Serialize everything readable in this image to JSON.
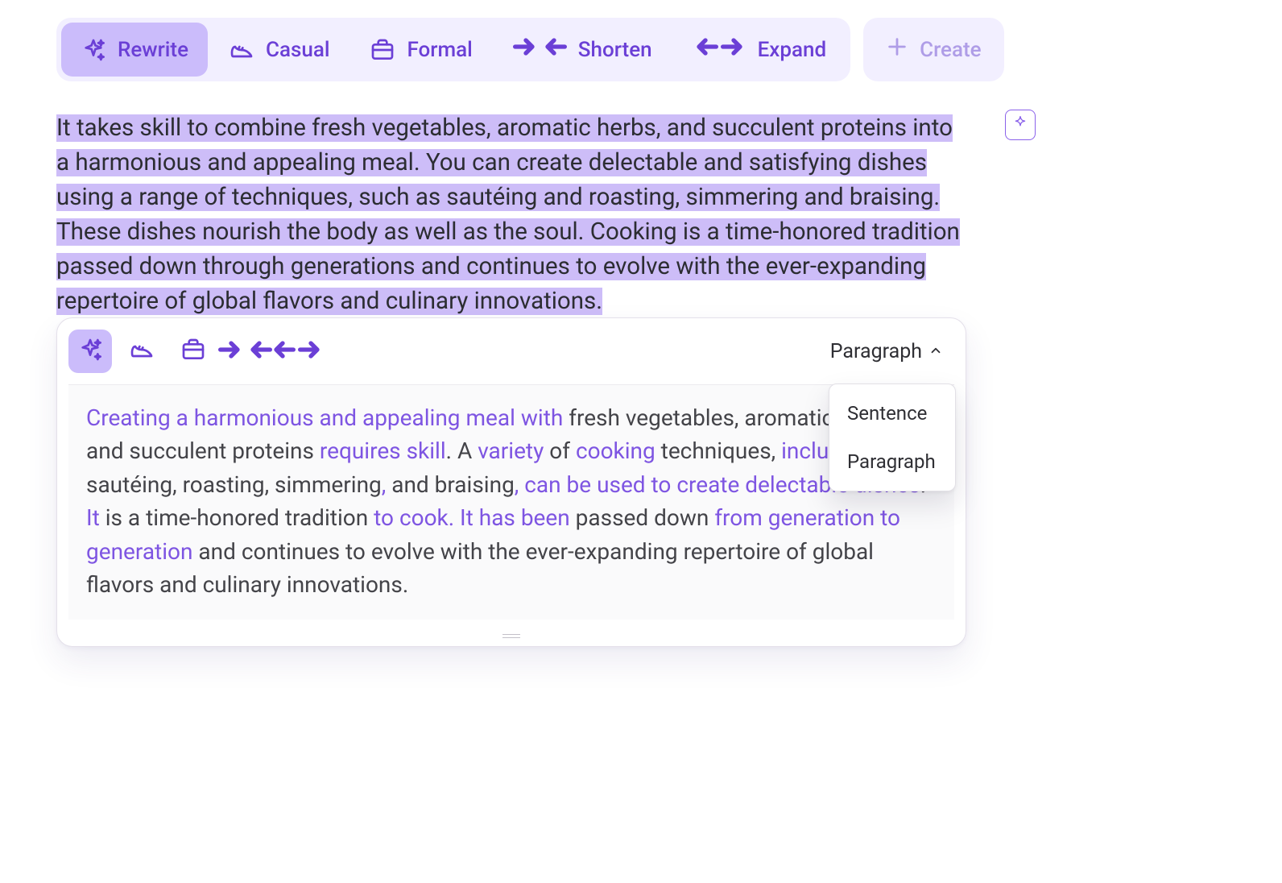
{
  "toolbar": {
    "rewrite": "Rewrite",
    "casual": "Casual",
    "formal": "Formal",
    "shorten": "Shorten",
    "expand": "Expand",
    "create": "Create"
  },
  "original_text": "It takes skill to combine fresh vegetables, aromatic herbs, and succulent proteins into a harmonious and appealing meal. You can create delectable and satisfying dishes using a range of techniques, such as sautéing and roasting, simmering and braising. These dishes nourish the body as well as the soul. Cooking is a time-honored tradition passed down through generations and continues to evolve with the ever-expanding repertoire of global flavors and culinary innovations.",
  "result": {
    "segments": [
      {
        "t": "Creating a harmonious and appealing meal with",
        "c": true
      },
      {
        "t": " fresh vegetables, aromatic herbs, and succulent proteins ",
        "c": false
      },
      {
        "t": "requires skill",
        "c": true
      },
      {
        "t": ". A ",
        "c": false
      },
      {
        "t": "variety",
        "c": true
      },
      {
        "t": " of ",
        "c": false
      },
      {
        "t": "cooking",
        "c": true
      },
      {
        "t": " techniques, ",
        "c": false
      },
      {
        "t": "including",
        "c": true
      },
      {
        "t": " sautéing, roasting, simmering",
        "c": false
      },
      {
        "t": ",",
        "c": true
      },
      {
        "t": " and braising",
        "c": false
      },
      {
        "t": ", can be used to create delectable dishes",
        "c": true
      },
      {
        "t": ". ",
        "c": false
      },
      {
        "t": "It",
        "c": true
      },
      {
        "t": " is a time-honored tradition ",
        "c": false
      },
      {
        "t": "to cook. It has been",
        "c": true
      },
      {
        "t": " passed down ",
        "c": false
      },
      {
        "t": "from generation to generation",
        "c": true
      },
      {
        "t": " and continues to evolve with the ever-expanding repertoire of global flavors and culinary innovations.",
        "c": false
      }
    ]
  },
  "scope": {
    "selected": "Paragraph",
    "options": [
      "Sentence",
      "Paragraph"
    ]
  },
  "icons": {
    "sparkle": "sparkle",
    "star4": "star4"
  }
}
